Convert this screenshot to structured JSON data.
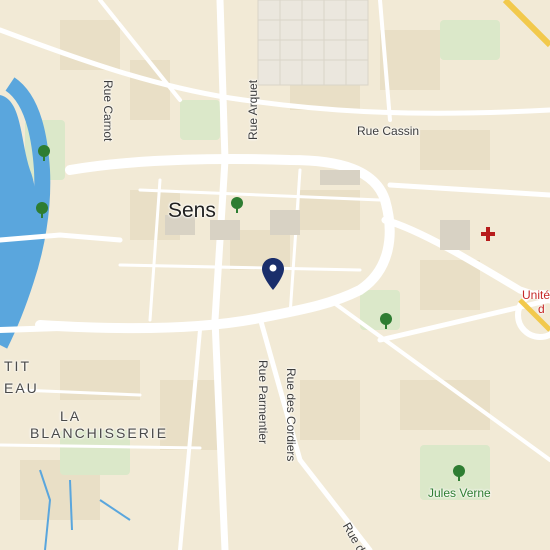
{
  "map": {
    "city_label": "Sens",
    "streets": {
      "rue_carnot": "Rue Carnot",
      "rue_arquet": "Rue Arquet",
      "rue_cassin": "Rue Cassin",
      "rue_parmentier": "Rue Parmentier",
      "rue_des_cordiers": "Rue des Cordiers",
      "rue_de": "Rue de"
    },
    "districts": {
      "petit_line1": "TIT",
      "petit_line2": "EAU",
      "blanchisserie_line1": "LA",
      "blanchisserie_line2": "BLANCHISSERIE"
    },
    "places": {
      "jules_verne": "Jules Verne",
      "unite_line1": "Unité",
      "unite_line2": "d"
    },
    "icons": [
      "park-tree-icon",
      "hospital-cross-icon",
      "location-pin-icon"
    ],
    "colors": {
      "land": "#f2ead6",
      "block": "#e9dfc6",
      "road": "#ffffff",
      "river": "#5aa6dd",
      "park": "#dbe8c9",
      "pin": "#1a2e6b",
      "hospital": "#b71c1c",
      "tree": "#2e7d32"
    }
  }
}
